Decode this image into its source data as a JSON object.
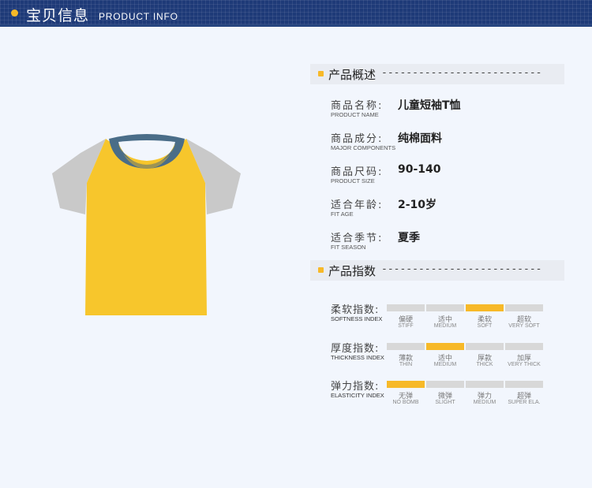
{
  "header": {
    "title": "宝贝信息",
    "subtitle": "PRODUCT INFO"
  },
  "colors": {
    "header_bg": "#1e3a78",
    "accent": "#f7b928",
    "shirt_body": "#f7c62c",
    "shirt_sleeve": "#c9c9c9",
    "shirt_collar": "#4a6d88"
  },
  "overview": {
    "title": "产品概述",
    "dashes": "--------------------------",
    "rows": [
      {
        "label": "商品名称:",
        "label_en": "PRODUCT NAME",
        "value": "儿童短袖T恤"
      },
      {
        "label": "商品成分:",
        "label_en": "MAJOR COMPONENTS",
        "value": "纯棉面料"
      },
      {
        "label": "商品尺码:",
        "label_en": "PRODUCT SIZE",
        "value": "90-140"
      },
      {
        "label": "适合年龄:",
        "label_en": "FIT AGE",
        "value": "2-10岁"
      },
      {
        "label": "适合季节:",
        "label_en": "FIT SEASON",
        "value": "夏季"
      }
    ]
  },
  "index": {
    "title": "产品指数",
    "dashes": "--------------------------",
    "rows": [
      {
        "label": "柔软指数:",
        "label_en": "SOFTNESS INDEX",
        "selected": 2,
        "options": [
          {
            "cn": "偏硬",
            "en": "STIFF"
          },
          {
            "cn": "适中",
            "en": "MEDIUM"
          },
          {
            "cn": "柔软",
            "en": "SOFT"
          },
          {
            "cn": "超软",
            "en": "VERY SOFT"
          }
        ]
      },
      {
        "label": "厚度指数:",
        "label_en": "THICKNESS INDEX",
        "selected": 1,
        "options": [
          {
            "cn": "薄款",
            "en": "THIN"
          },
          {
            "cn": "适中",
            "en": "MEDIUM"
          },
          {
            "cn": "厚款",
            "en": "THICK"
          },
          {
            "cn": "加厚",
            "en": "VERY THICK"
          }
        ]
      },
      {
        "label": "弹力指数:",
        "label_en": "ELASTICITY INDEX",
        "selected": 0,
        "options": [
          {
            "cn": "无弹",
            "en": "NO BOMB"
          },
          {
            "cn": "微弹",
            "en": "SLIGHT"
          },
          {
            "cn": "弹力",
            "en": "MEDIUM"
          },
          {
            "cn": "超弹",
            "en": "SUPER ELA."
          }
        ]
      }
    ]
  }
}
